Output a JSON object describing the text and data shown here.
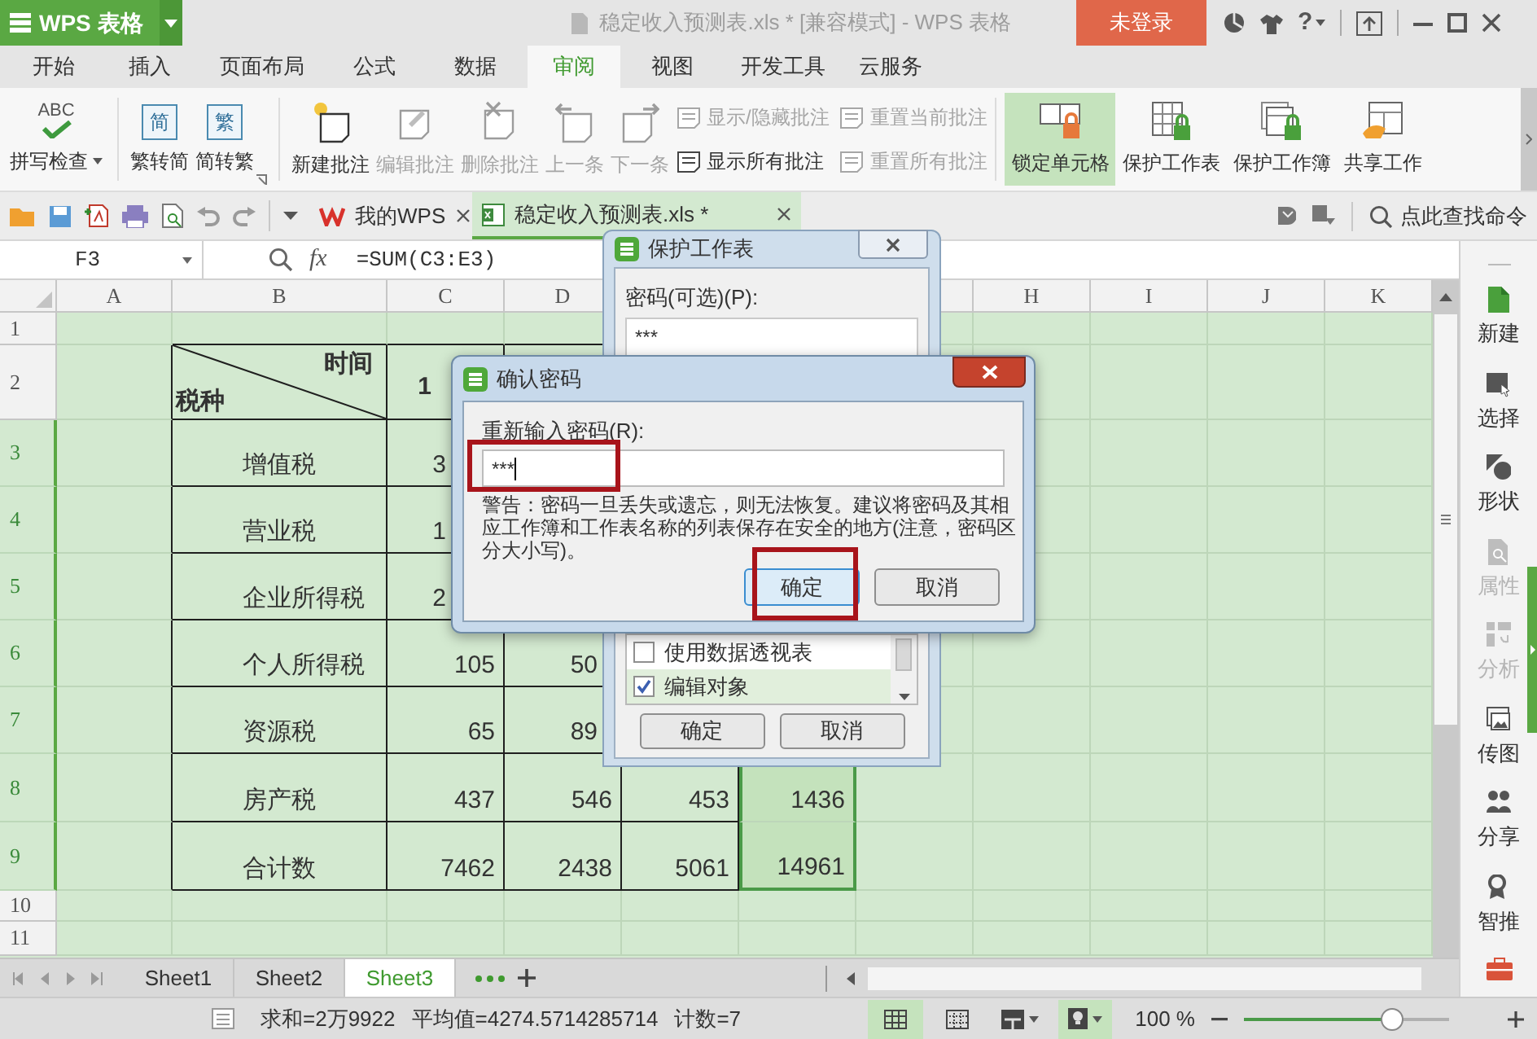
{
  "app": {
    "logo": "WPS 表格",
    "title": "稳定收入预测表.xls * [兼容模式] - WPS 表格",
    "login": "未登录",
    "help": "?"
  },
  "menu_tabs": [
    {
      "label": "开始",
      "selected": false
    },
    {
      "label": "插入",
      "selected": false
    },
    {
      "label": "页面布局",
      "selected": false
    },
    {
      "label": "公式",
      "selected": false
    },
    {
      "label": "数据",
      "selected": false
    },
    {
      "label": "审阅",
      "selected": true
    },
    {
      "label": "视图",
      "selected": false
    },
    {
      "label": "开发工具",
      "selected": false
    },
    {
      "label": "云服务",
      "selected": false
    }
  ],
  "ribbon": {
    "spell": {
      "label": "拼写检查",
      "icon_text": "ABC"
    },
    "convert": [
      {
        "label": "繁转简",
        "icon_text": "简"
      },
      {
        "label": "简转繁",
        "icon_text": "繁"
      }
    ],
    "comments": [
      {
        "label": "新建批注",
        "disabled": false
      },
      {
        "label": "编辑批注",
        "disabled": true
      },
      {
        "label": "删除批注",
        "disabled": true
      },
      {
        "label": "上一条",
        "disabled": true
      },
      {
        "label": "下一条",
        "disabled": true
      }
    ],
    "comment_options": [
      {
        "label": "显示/隐藏批注",
        "disabled": true
      },
      {
        "label": "显示所有批注",
        "disabled": false
      },
      {
        "label": "重置当前批注",
        "disabled": true
      },
      {
        "label": "重置所有批注",
        "disabled": true
      }
    ],
    "protection": [
      {
        "label": "锁定单元格",
        "on": true
      },
      {
        "label": "保护工作表",
        "on": false
      },
      {
        "label": "保护工作簿",
        "on": false
      },
      {
        "label": "共享工作",
        "on": false
      }
    ]
  },
  "doc_tabs": [
    {
      "label": "我的WPS",
      "selected": false
    },
    {
      "label": "稳定收入预测表.xls *",
      "selected": true
    }
  ],
  "command_search": "点此查找命令",
  "formula_bar": {
    "name_box": "F3",
    "fx": "fx",
    "formula": "=SUM(C3:E3)"
  },
  "sheet": {
    "columns_left": [
      "A",
      "B",
      "C",
      "D"
    ],
    "columns_right": [
      "H",
      "I",
      "J",
      "K"
    ],
    "rows": [
      {
        "label": "1",
        "selected": false
      },
      {
        "label": "2",
        "selected": false
      },
      {
        "label": "3",
        "selected": true
      },
      {
        "label": "4",
        "selected": true
      },
      {
        "label": "5",
        "selected": true
      },
      {
        "label": "6",
        "selected": true
      },
      {
        "label": "7",
        "selected": true
      },
      {
        "label": "8",
        "selected": true
      },
      {
        "label": "9",
        "selected": true
      },
      {
        "label": "10",
        "selected": false
      },
      {
        "label": "11",
        "selected": false
      }
    ],
    "table": {
      "corner_top": "时间",
      "corner_bottom": "税种",
      "header_values": [
        "1"
      ],
      "rows": [
        {
          "label": "增值税",
          "values": [
            "3"
          ]
        },
        {
          "label": "营业税",
          "values": [
            "1"
          ]
        },
        {
          "label": "企业所得税",
          "values": [
            "2"
          ]
        },
        {
          "label": "个人所得税",
          "values": [
            "105",
            "50"
          ]
        },
        {
          "label": "资源税",
          "values": [
            "65",
            "89"
          ]
        },
        {
          "label": "房产税",
          "values": [
            "437",
            "546",
            "453",
            "1436"
          ]
        },
        {
          "label": "合计数",
          "values": [
            "7462",
            "2438",
            "5061",
            "14961"
          ]
        }
      ]
    }
  },
  "sheet_tabs": [
    {
      "label": "Sheet1",
      "selected": false
    },
    {
      "label": "Sheet2",
      "selected": false
    },
    {
      "label": "Sheet3",
      "selected": true
    }
  ],
  "status_bar": {
    "sum": "求和=2万9922",
    "average": "平均值=4274.5714285714",
    "count": "计数=7",
    "zoom": "100 %",
    "zoom_slider": {
      "level": 0.75
    }
  },
  "task_pane": [
    {
      "label": "新建",
      "disabled": false
    },
    {
      "label": "选择",
      "disabled": false
    },
    {
      "label": "形状",
      "disabled": false
    },
    {
      "label": "属性",
      "disabled": true
    },
    {
      "label": "分析",
      "disabled": true
    },
    {
      "label": "传图",
      "disabled": false
    },
    {
      "label": "分享",
      "disabled": false
    },
    {
      "label": "智推",
      "disabled": false
    }
  ],
  "protect_dialog": {
    "title": "保护工作表",
    "password_label": "密码(可选)(P):",
    "password": "***",
    "permissions": [
      {
        "label": "使用数据透视表",
        "checked": false,
        "selected": false
      },
      {
        "label": "编辑对象",
        "checked": true,
        "selected": true
      }
    ],
    "ok": "确定",
    "cancel": "取消"
  },
  "confirm_dialog": {
    "title": "确认密码",
    "label": "重新输入密码(R):",
    "password": "***",
    "warning": "警告：密码一旦丢失或遗忘，则无法恢复。建议将密码及其相应工作簿和工作表名称的列表保存在安全的地方(注意，密码区分大小写)。",
    "ok": "确定",
    "cancel": "取消"
  }
}
